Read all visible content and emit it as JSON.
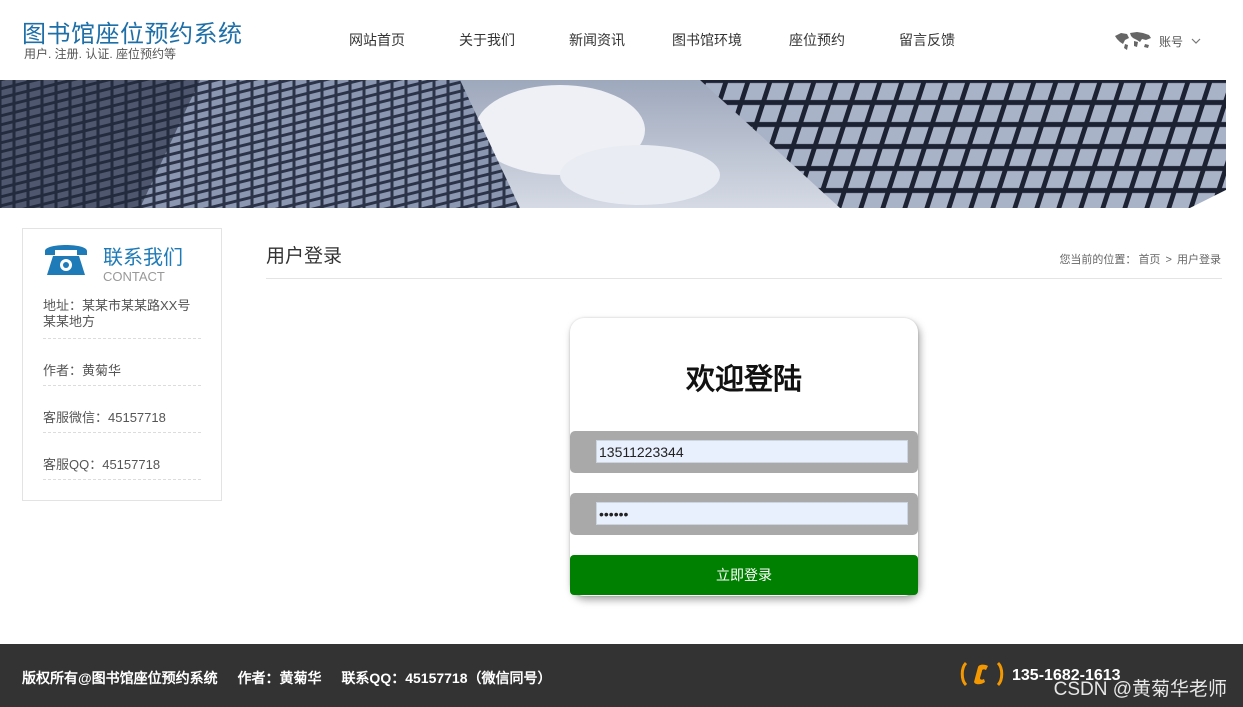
{
  "header": {
    "site_title": "图书馆座位预约系统",
    "site_subtitle": "用户. 注册. 认证. 座位预约等",
    "nav": [
      {
        "label": "网站首页"
      },
      {
        "label": "关于我们"
      },
      {
        "label": "新闻资讯"
      },
      {
        "label": "图书馆环境"
      },
      {
        "label": "座位预约"
      },
      {
        "label": "留言反馈"
      }
    ],
    "account_label": "账号",
    "account_icon": "world-map-icon",
    "account_arrow_icon": "chevron-down-icon"
  },
  "sidebar": {
    "title": "联系我们",
    "title_en": "CONTACT",
    "icon": "telephone-icon",
    "items": [
      {
        "text": "地址：某某市某某路XX号某某地方"
      },
      {
        "text": "作者：黄菊华"
      },
      {
        "text": "客服微信：45157718"
      },
      {
        "text": "客服QQ：45157718"
      }
    ]
  },
  "main": {
    "page_title": "用户登录",
    "breadcrumb": {
      "prefix": "您当前的位置：",
      "home": "首页",
      "separator": ">",
      "current": "用户登录"
    }
  },
  "login": {
    "heading": "欢迎登陆",
    "username_value": "13511223344",
    "password_value": "123456",
    "submit_label": "立即登录"
  },
  "footer": {
    "copyright": "版权所有@图书馆座位预约系统",
    "author": "作者：黄菊华",
    "contact": "联系QQ：45157718（微信同号）",
    "phone": "135-1682-1613",
    "phone_icon": "phone-icon",
    "watermark": "CSDN @黄菊华老师"
  },
  "colors": {
    "brand_blue": "#1e6fa8",
    "login_button": "#008000",
    "footer_bg": "#333333",
    "phone_accent": "#f39800"
  }
}
